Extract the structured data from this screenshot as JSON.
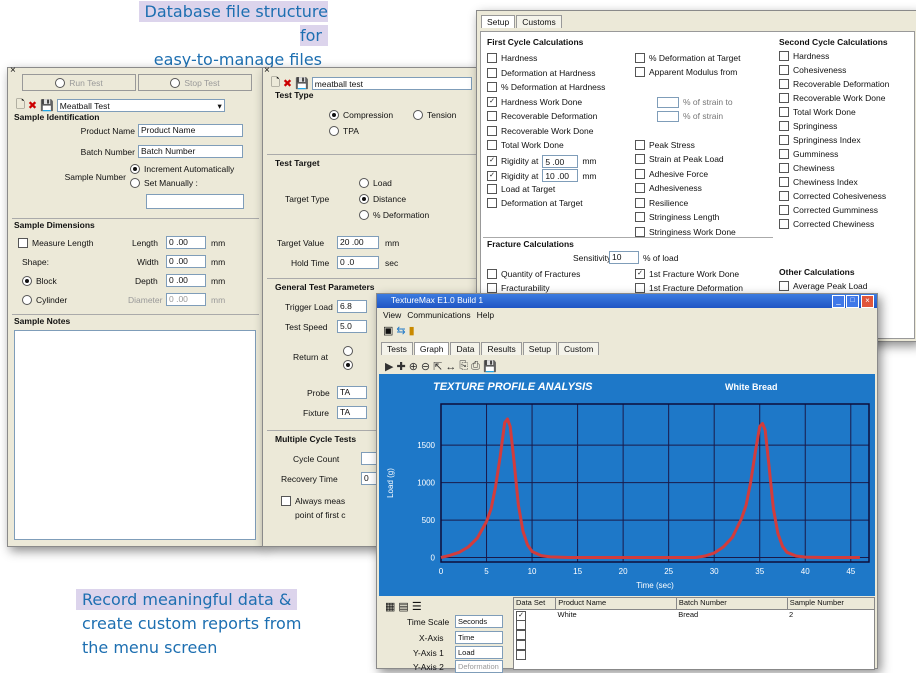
{
  "captions": {
    "top_line1": "Database file structure for",
    "top_line2": "easy-to-manage files",
    "bottom_line1": "Record meaningful data &",
    "bottom_line2": "create custom reports from",
    "bottom_line3": "the menu screen"
  },
  "left_window": {
    "run_test": "Run Test",
    "stop_test": "Stop Test",
    "file_name": "Meatball Test",
    "sample_identification": "Sample Identification",
    "product_name_label": "Product Name",
    "product_name_value": "Product Name",
    "batch_number_label": "Batch Number",
    "batch_number_value": "Batch Number",
    "sample_number_label": "Sample Number",
    "increment_auto": "Increment Automatically",
    "set_manually": "Set Manually :",
    "sample_dimensions": "Sample Dimensions",
    "measure_length": "Measure Length",
    "length_label": "Length",
    "length_value": "0 .00",
    "width_label": "Width",
    "width_value": "0 .00",
    "depth_label": "Depth",
    "depth_value": "0 .00",
    "diameter_label": "Diameter",
    "diameter_value": "0 .00",
    "unit_mm": "mm",
    "shape_label": "Shape:",
    "block": "Block",
    "cylinder": "Cylinder",
    "sample_notes": "Sample Notes"
  },
  "middle_window": {
    "file_name": "meatball test",
    "test_type": "Test Type",
    "compression": "Compression",
    "tension": "Tension",
    "tpa": "TPA",
    "test_target": "Test Target",
    "load": "Load",
    "target_type_label": "Target Type",
    "distance": "Distance",
    "pct_deformation": "% Deformation",
    "target_value_label": "Target Value",
    "target_value": "20 .00",
    "target_value_unit": "mm",
    "hold_time_label": "Hold Time",
    "hold_time": "0 .0",
    "hold_time_unit": "sec",
    "general_params": "General Test Parameters",
    "trigger_load_label": "Trigger Load",
    "trigger_load": "6.8",
    "test_speed_label": "Test Speed",
    "test_speed": "5.0",
    "return_at_label": "Return at",
    "probe_label": "Probe",
    "probe_value": "TA",
    "fixture_label": "Fixture",
    "fixture_value": "TA",
    "multiple_cycle": "Multiple Cycle Tests",
    "cycle_count_label": "Cycle Count",
    "recovery_time_label": "Recovery Time",
    "recovery_time": "0",
    "always_measure": "Always meas",
    "point_first": "point of first c"
  },
  "right_window": {
    "tab_setup": "Setup",
    "tab_customs": "Customs",
    "first_cycle": "First Cycle Calculations",
    "col1": [
      {
        "label": "Hardness",
        "checked": false
      },
      {
        "label": "Deformation at Hardness",
        "checked": false
      },
      {
        "label": "% Deformation at Hardness",
        "checked": false
      },
      {
        "label": "Hardness Work Done",
        "checked": true
      },
      {
        "label": "Recoverable Deformation",
        "checked": false
      },
      {
        "label": "Recoverable Work Done",
        "checked": false
      },
      {
        "label": "Total Work Done",
        "checked": false
      },
      {
        "label": "Rigidity at",
        "checked": true,
        "value": "5 .00",
        "unit": "mm"
      },
      {
        "label": "Rigidity at",
        "checked": true,
        "value": "10 .00",
        "unit": "mm"
      },
      {
        "label": "Load at Target",
        "checked": false
      },
      {
        "label": "Deformation at Target",
        "checked": false
      }
    ],
    "col2": [
      {
        "label": "% Deformation at Target",
        "checked": false
      },
      {
        "label": "Apparent Modulus from",
        "checked": false
      },
      {
        "label": "Peak Stress",
        "checked": false
      },
      {
        "label": "Strain at Peak Load",
        "checked": false
      },
      {
        "label": "Adhesive Force",
        "checked": false
      },
      {
        "label": "Adhesiveness",
        "checked": false
      },
      {
        "label": "Resilience",
        "checked": false
      },
      {
        "label": "Stringiness Length",
        "checked": false
      },
      {
        "label": "Stringiness Work Done",
        "checked": false
      }
    ],
    "modulus_strain1": "% of strain to",
    "modulus_strain2": "% of strain",
    "second_cycle": "Second Cycle Calculations",
    "col3": [
      "Hardness",
      "Cohesiveness",
      "Recoverable Deformation",
      "Recoverable Work Done",
      "Total Work Done",
      "Springiness",
      "Springiness Index",
      "Gumminess",
      "Chewiness",
      "Chewiness Index",
      "Corrected Cohesiveness",
      "Corrected Gumminess",
      "Corrected Chewiness"
    ],
    "fracture": "Fracture Calculations",
    "sensitivity_label": "Sensitivity",
    "sensitivity_value": "10",
    "sensitivity_unit": "% of load",
    "quantity_fractures": "Quantity of Fractures",
    "fracturability": "Fracturability",
    "first_fracture_work": "1st Fracture Work Done",
    "first_fracture_def": "1st Fracture Deformation",
    "other_calc": "Other Calculations",
    "average_peak": "Average Peak Load"
  },
  "graph_window": {
    "title": "TextureMax E1.0 Build 1",
    "menu": [
      "View",
      "Communications",
      "Help"
    ],
    "tabs": [
      "Tests",
      "Graph",
      "Data",
      "Results",
      "Setup",
      "Custom"
    ],
    "selected_tab": "Graph",
    "chart_label_left": "TEXTURE PROFILE ANALYSIS",
    "chart_label_right": "White Bread",
    "time_scale_label": "Time Scale",
    "time_scale_value": "Seconds",
    "x_axis_label": "X-Axis",
    "x_axis_value": "Time",
    "y1_axis_label": "Y-Axis 1",
    "y1_axis_value": "Load",
    "y2_axis_label": "Y-Axis 2",
    "y2_axis_value": "Deformation",
    "grid_headers": [
      "Data Set",
      "Product Name",
      "Batch Number",
      "Sample Number"
    ],
    "grid_row": [
      "White",
      "Bread",
      "2"
    ],
    "accent": "#1e78c8",
    "curve_color": "#d23c3c"
  },
  "chart_data": {
    "type": "line",
    "title": "TEXTURE PROFILE ANALYSIS",
    "subtitle": "White Bread",
    "xlabel": "Time (sec)",
    "ylabel": "Load (g)",
    "xlim": [
      0,
      47
    ],
    "ylim": [
      -60,
      2050
    ],
    "xticks": [
      0,
      5,
      10,
      15,
      20,
      25,
      30,
      35,
      40,
      45
    ],
    "yticks": [
      0,
      500,
      1000,
      1500
    ],
    "grid": true,
    "series": [
      {
        "x": [
          0,
          1,
          2,
          3,
          4,
          5,
          5.5,
          6,
          6.5,
          7,
          7.3,
          7.6,
          8,
          8.5,
          9,
          9.5,
          10,
          11,
          12,
          14,
          16,
          18,
          20,
          22,
          24,
          26,
          28,
          29,
          30,
          31,
          32,
          33,
          33.5,
          34,
          34.5,
          35,
          35.3,
          35.6,
          36,
          36.5,
          37,
          37.5,
          38,
          39,
          40,
          42,
          44,
          46
        ],
        "y": [
          0,
          30,
          70,
          140,
          260,
          480,
          650,
          950,
          1350,
          1800,
          1850,
          1750,
          1300,
          700,
          350,
          170,
          80,
          25,
          8,
          0,
          0,
          0,
          0,
          0,
          0,
          0,
          0,
          20,
          60,
          140,
          270,
          520,
          700,
          1000,
          1400,
          1750,
          1790,
          1700,
          1250,
          650,
          320,
          150,
          70,
          20,
          5,
          0,
          0,
          0
        ]
      }
    ]
  }
}
